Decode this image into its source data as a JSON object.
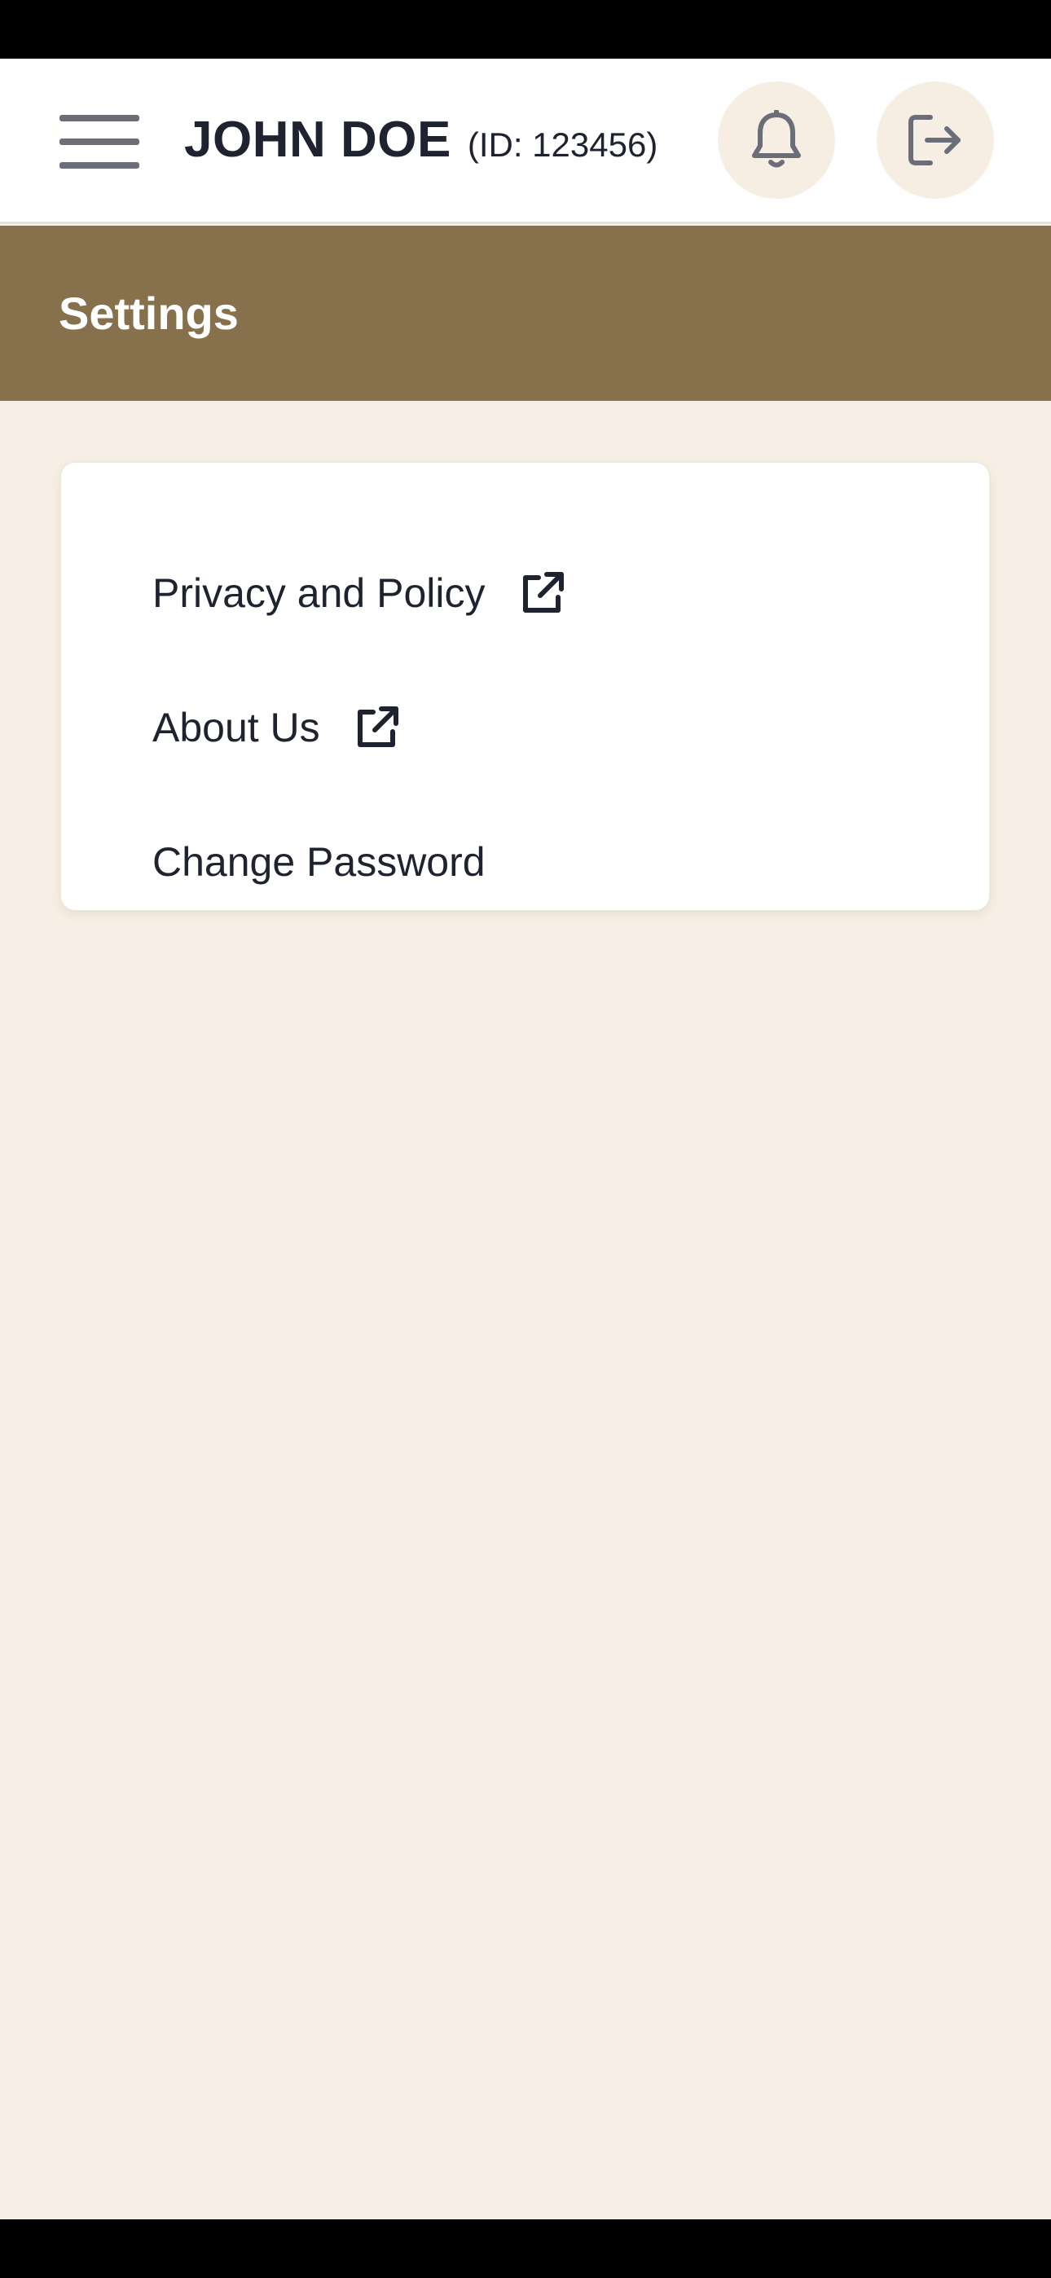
{
  "header": {
    "user_name": "JOHN DOE",
    "user_id": "(ID: 123456)",
    "menu_icon": "hamburger-menu-icon",
    "notification_icon": "bell-icon",
    "logout_icon": "logout-icon"
  },
  "settings": {
    "title": "Settings",
    "items": [
      {
        "label": "Privacy and Policy",
        "icon": "external-link-icon"
      },
      {
        "label": "About Us",
        "icon": "external-link-icon"
      },
      {
        "label": "Change Password"
      }
    ]
  },
  "colors": {
    "banner": "#87714c",
    "page_background": "#f7efe5",
    "icon_circle": "#f6eee3",
    "text": "#1f2330",
    "icon_gray": "#6b6e78"
  }
}
